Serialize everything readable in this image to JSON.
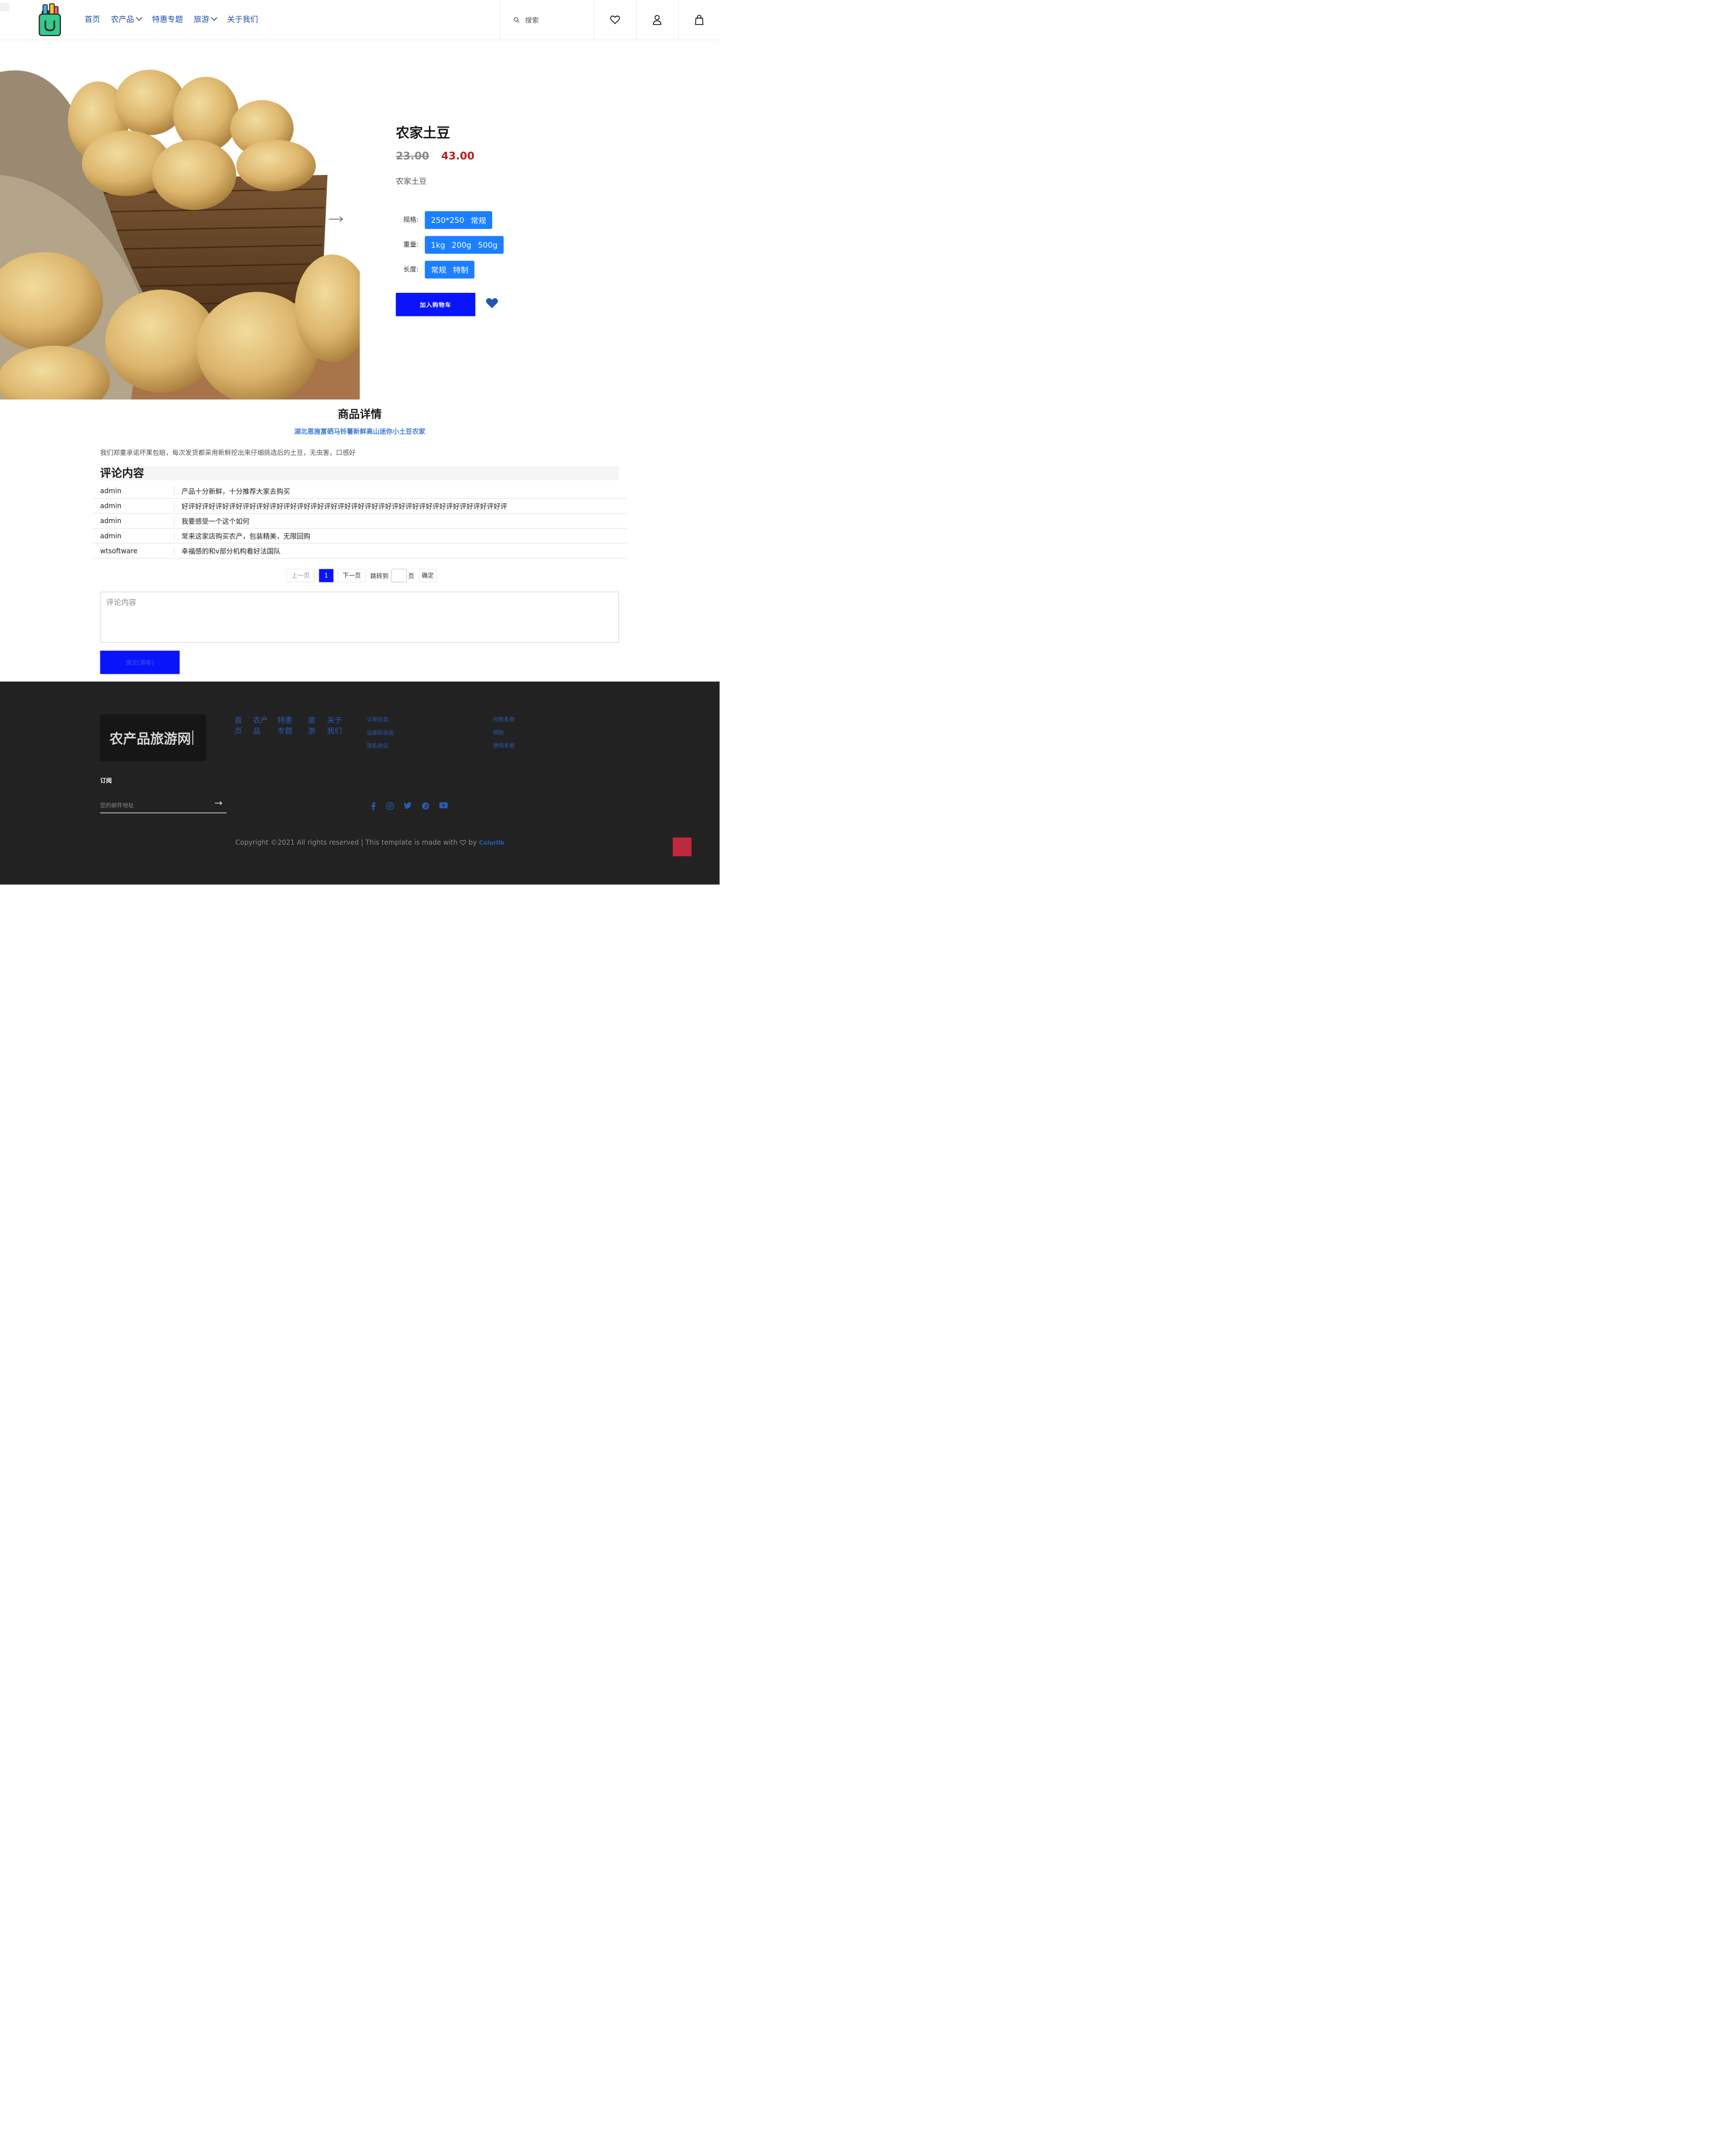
{
  "header": {
    "nav": [
      {
        "label": "首页",
        "has_dropdown": false
      },
      {
        "label": "农产品",
        "has_dropdown": true
      },
      {
        "label": "特惠专题",
        "has_dropdown": false
      },
      {
        "label": "旅游",
        "has_dropdown": true
      },
      {
        "label": "关于我们",
        "has_dropdown": false
      }
    ],
    "search_placeholder": "搜索",
    "icons": [
      "heart-icon",
      "user-icon",
      "shopping-bag-icon"
    ]
  },
  "product": {
    "title": "农家土豆",
    "old_price": "23.00",
    "new_price": "43.00",
    "description": "农家土豆",
    "options": [
      {
        "label": "规格:",
        "values": [
          "250*250",
          "常规"
        ]
      },
      {
        "label": "重量:",
        "values": [
          "1kg",
          "200g",
          "500g"
        ]
      },
      {
        "label": "长度:",
        "values": [
          "常规",
          "特制"
        ]
      }
    ],
    "add_to_cart": "加入购物车"
  },
  "details": {
    "title": "商品详情",
    "subtitle": "湖北恩施富硒马铃薯新鲜高山迷你小土豆农家",
    "text": "我们郑重承诺坏果包赔，每次发货都采用新鲜挖出来仔细挑选后的土豆，无虫害，口感好"
  },
  "comments": {
    "title": "评论内容",
    "rows": [
      {
        "user": "admin",
        "text": "产品十分新鲜，十分推荐大家去购买"
      },
      {
        "user": "admin",
        "text": "好评好评好评好评好评好评好评好评好评好评好评好评好评好评好评好评好评好评好评好评好评好评好评好评"
      },
      {
        "user": "admin",
        "text": "我要感受一个这个如何"
      },
      {
        "user": "admin",
        "text": "常来这家店购买农产，包装精美，无限回购"
      },
      {
        "user": "wtsoftware",
        "text": "幸福感的和v部分机构看好法国队"
      }
    ],
    "pager": {
      "prev": "上一页",
      "current": "1",
      "next": "下一页",
      "jump_label": "跳转到",
      "page_unit": "页",
      "confirm": "确定"
    },
    "input_placeholder": "评论内容",
    "submit": "提交(游客)"
  },
  "footer": {
    "logo_text": "农产品旅游网",
    "nav": [
      {
        "line1": "首",
        "line2": "页"
      },
      {
        "line1": "农产",
        "line2": "品"
      },
      {
        "line1": "特惠",
        "line2": "专题"
      },
      {
        "line1": "旅",
        "line2": "游"
      },
      {
        "line1": "关于",
        "line2": "我们"
      }
    ],
    "links_col1": [
      "订单状态",
      "运输和派送",
      "隐私协议"
    ],
    "links_col2": [
      "付款条款",
      "帮助",
      "使用条款"
    ],
    "subscribe_label": "订阅",
    "email_placeholder": "您的邮件地址",
    "social": [
      "facebook-icon",
      "instagram-icon",
      "twitter-icon",
      "pinterest-icon",
      "youtube-icon"
    ],
    "copyright": "Copyright ©2021 All rights reserved | This template is made with",
    "by": "by",
    "author": "Colorlib"
  },
  "colors": {
    "accent": "#0a14fa",
    "price": "#b2221f",
    "option_bg": "#1b7fff",
    "footer_bg": "#222222",
    "link": "#2a5bb5",
    "to_top": "#c2283c"
  }
}
